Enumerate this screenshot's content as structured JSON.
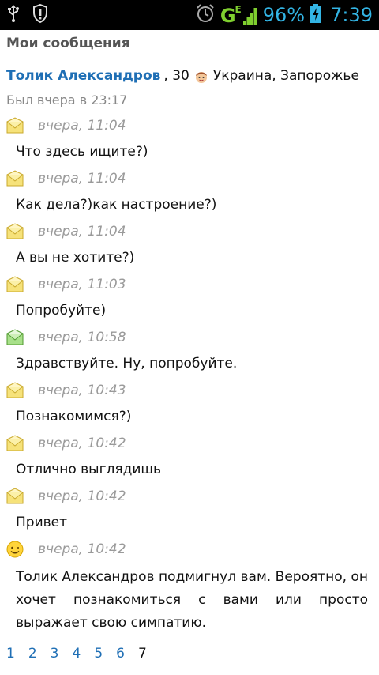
{
  "status_bar": {
    "network": "G",
    "network_sub": "E",
    "battery_percent": "96%",
    "time": "7:39"
  },
  "page": {
    "title": "Мои сообщения"
  },
  "user": {
    "name": "Толик Александров",
    "age": ", 30",
    "location": "Украина,  Запорожье",
    "last_seen": "Был вчера  в  23:17"
  },
  "messages": [
    {
      "icon": "envelope-icon",
      "time": "вчера, 11:04",
      "text": "Что  здесь  ищите?)"
    },
    {
      "icon": "envelope-icon",
      "time": "вчера, 11:04",
      "text": "Как  дела?)как   настроение?)"
    },
    {
      "icon": "envelope-icon",
      "time": "вчера, 11:04",
      "text": "А  вы  не  хотите?)"
    },
    {
      "icon": "envelope-icon",
      "time": "вчера, 11:03",
      "text": "Попробуйте)"
    },
    {
      "icon": "envelope-green-icon",
      "time": "вчера, 10:58",
      "text": "Здравствуйте.  Ну,  попробуйте."
    },
    {
      "icon": "envelope-icon",
      "time": "вчера, 10:43",
      "text": "Познакомимся?)"
    },
    {
      "icon": "envelope-icon",
      "time": "вчера, 10:42",
      "text": "Отлично  выглядишь"
    },
    {
      "icon": "envelope-icon",
      "time": "вчера, 10:42",
      "text": "Привет"
    },
    {
      "icon": "smiley-icon",
      "time": "вчера, 10:42",
      "text": "Толик  Александров  подмигнул  вам.  Вероятно,  он хочет  познакомиться  с  вами  или  просто  выражает  свою  симпатию."
    }
  ],
  "pagination": {
    "pages": [
      "1",
      "2",
      "3",
      "4",
      "5",
      "6"
    ],
    "current": "7"
  },
  "colors": {
    "link": "#1f6fb5",
    "status_accent": "#33b5e5",
    "network_green": "#7fcf2f"
  }
}
